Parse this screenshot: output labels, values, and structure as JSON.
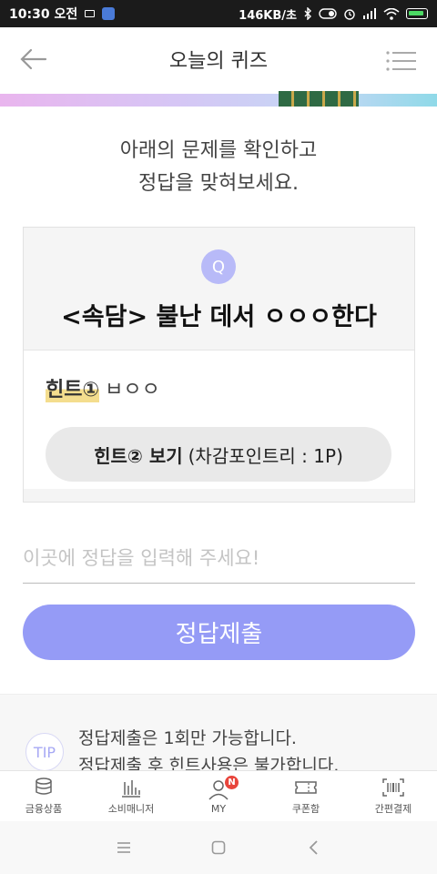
{
  "status_bar": {
    "time": "10:30 오전",
    "network_speed": "146KB/초"
  },
  "header": {
    "title": "오늘의 퀴즈"
  },
  "instruction": "아래의 문제를 확인하고\n정답을 맞혀보세요.",
  "quiz": {
    "q_badge": "Q",
    "question": "<속담> 불난 데서 ㅇㅇㅇ한다",
    "hint1_label": "힌트①",
    "hint1_value": "ㅂㅇㅇ",
    "hint2_label": "힌트② 보기",
    "hint2_cost": "(차감포인트리 : 1P)"
  },
  "answer": {
    "placeholder": "이곳에 정답을 입력해 주세요!",
    "submit_label": "정답제출"
  },
  "tip": {
    "badge": "TIP",
    "line1": "정답제출은 1회만 가능합니다.",
    "line2": "정답제출 후 힌트사용은 불가합니다."
  },
  "bottom_nav": {
    "items": [
      {
        "label": "금융상품",
        "icon": "coins-icon"
      },
      {
        "label": "소비매니저",
        "icon": "bar-chart-icon"
      },
      {
        "label": "MY",
        "icon": "person-icon",
        "badge": "N"
      },
      {
        "label": "쿠폰함",
        "icon": "ticket-icon"
      },
      {
        "label": "간편결제",
        "icon": "barcode-icon"
      }
    ]
  },
  "colors": {
    "accent": "#959bf6",
    "q_badge": "#b8baf8",
    "highlight": "#f4dd8e",
    "notification": "#e8453c"
  }
}
